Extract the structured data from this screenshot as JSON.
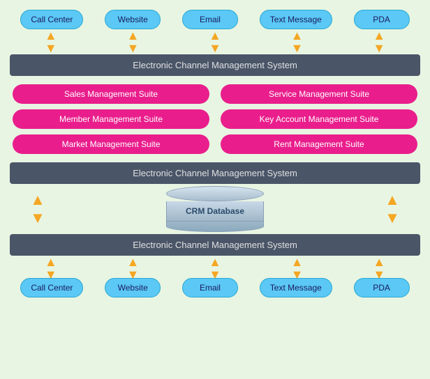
{
  "channels_top": [
    {
      "label": "Call Center"
    },
    {
      "label": "Website"
    },
    {
      "label": "Email"
    },
    {
      "label": "Text Message"
    },
    {
      "label": "PDA"
    }
  ],
  "channels_bottom": [
    {
      "label": "Call Center"
    },
    {
      "label": "Website"
    },
    {
      "label": "Email"
    },
    {
      "label": "Text Message"
    },
    {
      "label": "PDA"
    }
  ],
  "band1": "Electronic Channel Management System",
  "band2": "Electronic Channel Management System",
  "band3": "Electronic Channel Management System",
  "suites": [
    {
      "label": "Sales Management Suite"
    },
    {
      "label": "Service Management Suite"
    },
    {
      "label": "Member Management Suite"
    },
    {
      "label": "Key Account Management Suite"
    },
    {
      "label": "Market Management Suite"
    },
    {
      "label": "Rent Management Suite"
    }
  ],
  "crm_label": "CRM Database",
  "arrows": {
    "up_symbol": "▲",
    "down_symbol": "▼"
  }
}
